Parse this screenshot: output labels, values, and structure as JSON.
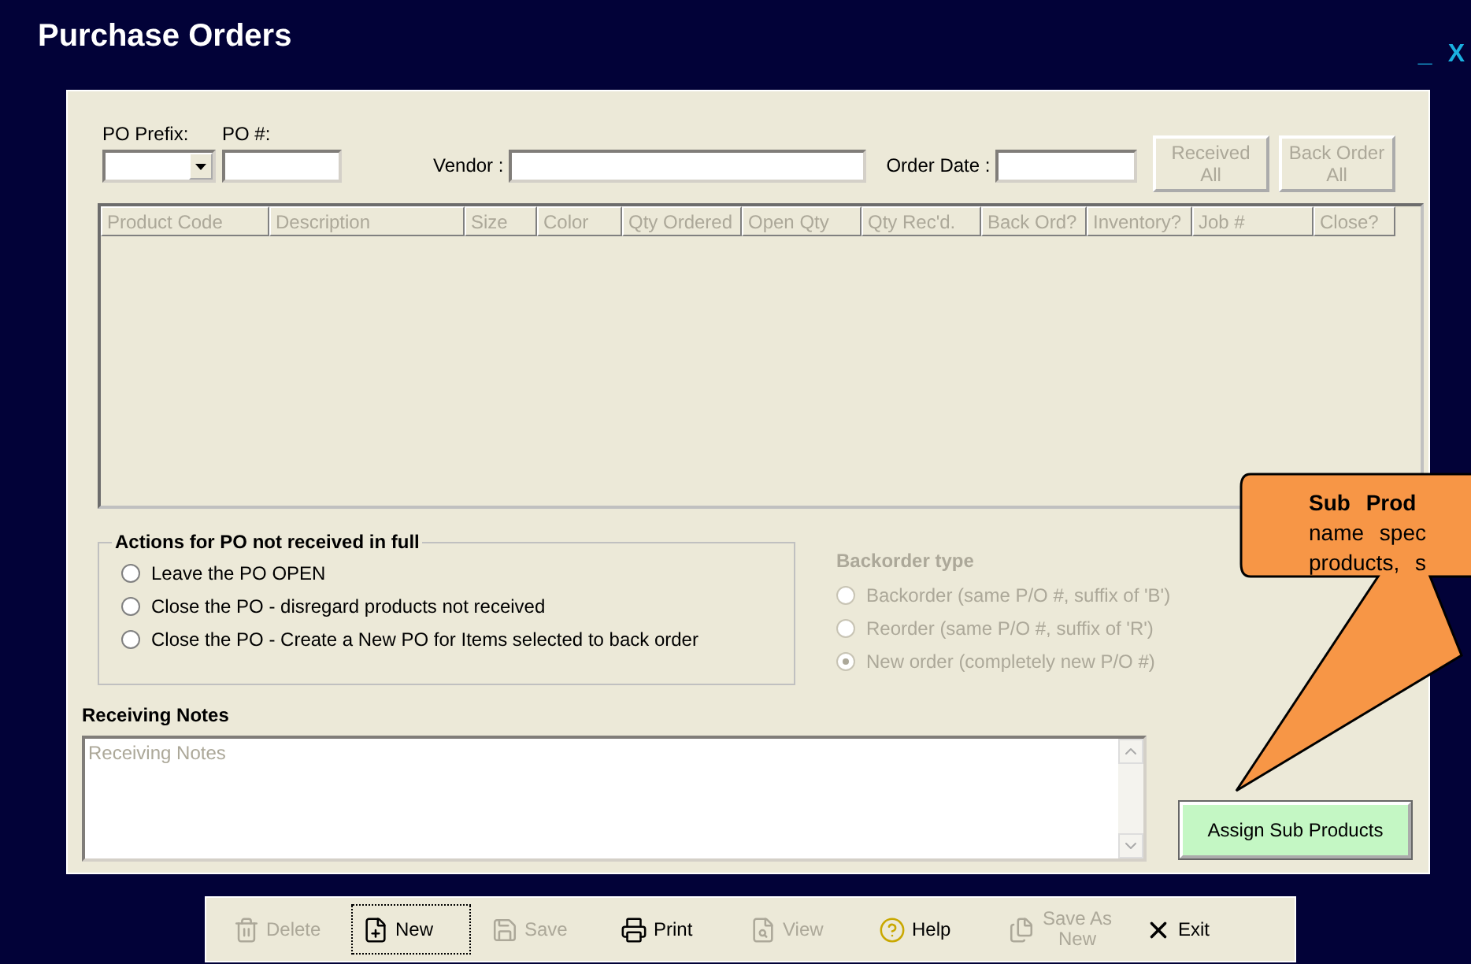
{
  "window": {
    "title": "Purchase Orders",
    "controls": [
      "_",
      "X"
    ]
  },
  "header": {
    "po_prefix_label": "PO Prefix:",
    "po_number_label": "PO #:",
    "vendor_label": "Vendor :",
    "order_date_label": "Order Date :",
    "buttons": [
      {
        "label": "Received All",
        "disabled": true
      },
      {
        "label": "Back Order All",
        "disabled": true
      }
    ]
  },
  "table": {
    "columns": [
      "Product Code",
      "Description",
      "Size",
      "Color",
      "Qty Ordered",
      "Open Qty",
      "Qty Rec'd.",
      "Back Ord?",
      "Inventory?",
      "Job #",
      "Close?"
    ]
  },
  "actions": {
    "title": "Actions for PO not received in full",
    "options": [
      {
        "label": "Leave the PO OPEN",
        "selected": false
      },
      {
        "label": "Close the PO - disregard products not received",
        "selected": false
      },
      {
        "label": "Close the PO - Create a New PO for Items selected to back order",
        "selected": false
      }
    ]
  },
  "backorder": {
    "title": "Backorder type",
    "disabled": true,
    "options": [
      {
        "label": "Backorder (same P/O #, suffix of 'B')",
        "selected": false
      },
      {
        "label": "Reorder (same P/O #, suffix of 'R')",
        "selected": false
      },
      {
        "label": "New order (completely new P/O #)",
        "selected": true
      }
    ]
  },
  "notes": {
    "label": "Receiving Notes",
    "placeholder": "Receiving Notes"
  },
  "assign_button": {
    "label": "Assign Sub Products"
  },
  "callout": {
    "lines": [
      "**Sub Prod**",
      "name spec",
      "products, s"
    ]
  },
  "toolbar": [
    {
      "label": "Delete",
      "kind": "trash",
      "disabled": true,
      "focused": false
    },
    {
      "label": "New",
      "kind": "new",
      "disabled": false,
      "focused": true
    },
    {
      "label": "Save",
      "kind": "save",
      "disabled": true,
      "focused": false
    },
    {
      "label": "Print",
      "kind": "print",
      "disabled": false,
      "focused": false
    },
    {
      "label": "View",
      "kind": "view",
      "disabled": true,
      "focused": false
    },
    {
      "label": "Help",
      "kind": "help",
      "disabled": false,
      "focused": false
    },
    {
      "label": "Save As New",
      "kind": "saveas",
      "disabled": true,
      "focused": false
    },
    {
      "label": "Exit",
      "kind": "exit",
      "disabled": false,
      "focused": false
    }
  ]
}
